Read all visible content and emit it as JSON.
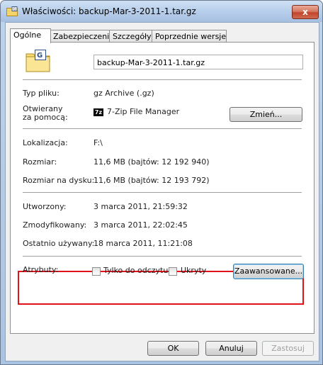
{
  "window": {
    "title": "Właściwości: backup-Mar-3-2011-1.tar.gz",
    "close_label": "x"
  },
  "tabs": [
    {
      "label": "Ogólne"
    },
    {
      "label": "Zabezpieczenia"
    },
    {
      "label": "Szczegóły"
    },
    {
      "label": "Poprzednie wersje"
    }
  ],
  "general": {
    "file_name": "backup-Mar-3-2011-1.tar.gz",
    "type_label": "Typ pliku:",
    "type_value": "gz Archive (.gz)",
    "opens_with_label_line1": "Otwierany",
    "opens_with_label_line2": "za pomocą:",
    "opens_with_icon_text": "7z",
    "opens_with_value": "7-Zip File Manager",
    "change_button": "Zmień...",
    "location_label": "Lokalizacja:",
    "location_value": "F:\\",
    "size_label": "Rozmiar:",
    "size_value": "11,6 MB (bajtów: 12 192 940)",
    "size_on_disk_label": "Rozmiar na dysku:",
    "size_on_disk_value": "11,6 MB (bajtów: 12 193 792)",
    "created_label": "Utworzony:",
    "created_value": "3 marca 2011, 21:59:32",
    "modified_label": "Zmodyfikowany:",
    "modified_value": "3 marca 2011, 22:02:45",
    "accessed_label": "Ostatnio używany:",
    "accessed_value": "18 marca 2011, 11:21:08",
    "attributes_label": "Atrybuty:",
    "readonly_label": "Tylko do odczytu",
    "readonly_checked": false,
    "hidden_label": "Ukryty",
    "hidden_checked": false,
    "advanced_button": "Zaawansowane..."
  },
  "footer": {
    "ok": "OK",
    "cancel": "Anuluj",
    "apply": "Zastosuj"
  },
  "colors": {
    "highlight_box": "#e0121a",
    "title_gradient": "#b7cfeb"
  }
}
